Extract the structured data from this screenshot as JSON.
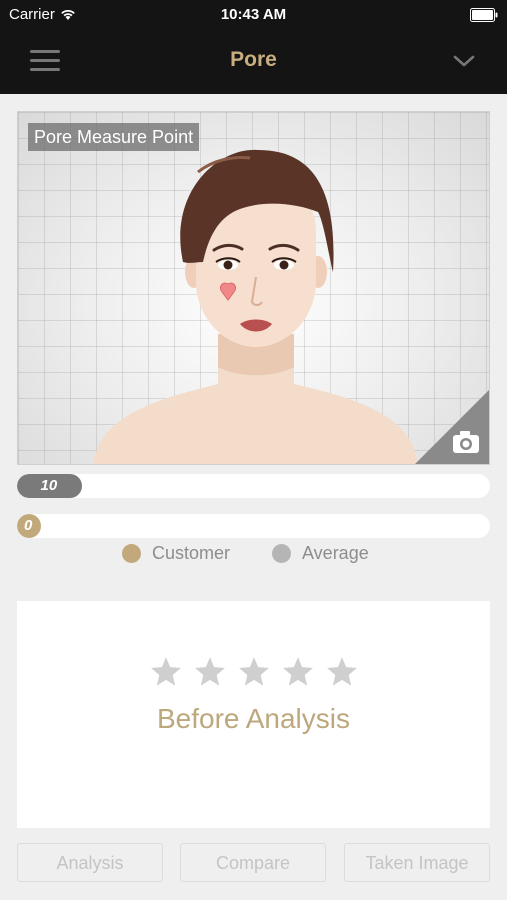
{
  "status_bar": {
    "carrier": "Carrier",
    "time": "10:43 AM",
    "icons": [
      "wifi-icon",
      "battery-icon"
    ]
  },
  "nav": {
    "title": "Pore",
    "menu_icon": "hamburger-menu-icon",
    "dropdown_icon": "chevron-down-icon"
  },
  "face_panel": {
    "label": "Pore Measure Point",
    "camera_icon": "camera-icon"
  },
  "scores": {
    "customer": {
      "value": "10",
      "level": 0.14
    },
    "average": {
      "value": "0",
      "level": 0.0
    }
  },
  "legend": {
    "customer": "Customer",
    "average": "Average"
  },
  "result": {
    "rating": 0,
    "max_rating": 5,
    "status": "Before Analysis"
  },
  "buttons": {
    "analysis": "Analysis",
    "compare": "Compare",
    "taken_image": "Taken Image"
  },
  "colors": {
    "nav_background": "#141414",
    "nav_title": "#c8ad7f",
    "customer": "#c2a97c",
    "average": "#b5b5b5",
    "result_text": "#bda77c"
  }
}
